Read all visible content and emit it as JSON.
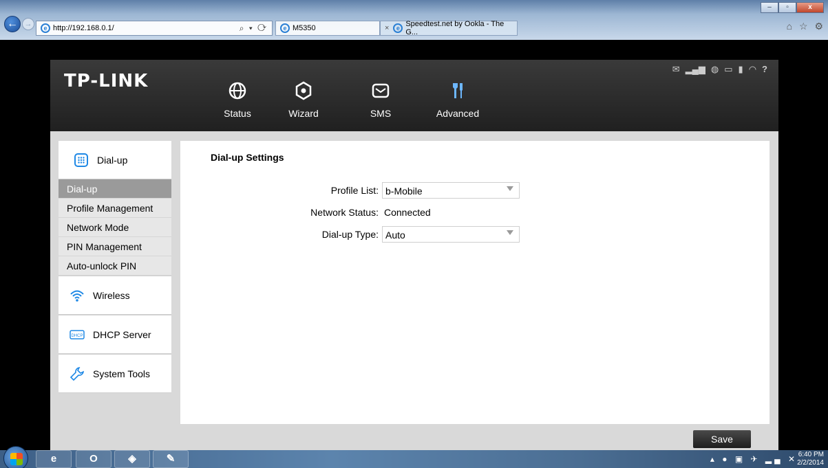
{
  "browser": {
    "address": "http://192.168.0.1/",
    "address_tools": "⌕ ▾ ⟳",
    "tabs": [
      {
        "title": "M5350"
      },
      {
        "title": "Speedtest.net by Ookla - The G..."
      }
    ],
    "tab_close": "×",
    "favorites_icons": "⌂ ☆ ⚙"
  },
  "router": {
    "brand": "TP-LINK",
    "nav": [
      {
        "label": "Status",
        "icon": "globe-icon"
      },
      {
        "label": "Wizard",
        "icon": "wizard-icon"
      },
      {
        "label": "SMS",
        "icon": "envelope-icon"
      },
      {
        "label": "Advanced",
        "icon": "tools-icon",
        "active": true
      }
    ],
    "status_icons": [
      "envelope-icon",
      "signal-icon",
      "globe-icon",
      "battery-icon",
      "sim-icon",
      "wifi-icon",
      "help-icon"
    ],
    "sidebar": {
      "header": "Dial-up",
      "items": [
        "Dial-up",
        "Profile Management",
        "Network Mode",
        "PIN Management",
        "Auto-unlock PIN"
      ],
      "active_index": 0,
      "groups": [
        "Wireless",
        "DHCP Server",
        "System Tools"
      ]
    },
    "main": {
      "title": "Dial-up Settings",
      "profile_label": "Profile List:",
      "profile_value": "b-Mobile",
      "status_label": "Network Status:",
      "status_value": "Connected",
      "type_label": "Dial-up Type:",
      "type_value": "Auto"
    },
    "save_label": "Save",
    "dhcp_icon_text": "DHCP"
  },
  "taskbar": {
    "time": "6:40 PM",
    "date": "2/2/2014"
  },
  "colors": {
    "accent": "#6db7ff",
    "header_bg": "#2b2b2b",
    "sidebar_active": "#9a9a9a"
  }
}
